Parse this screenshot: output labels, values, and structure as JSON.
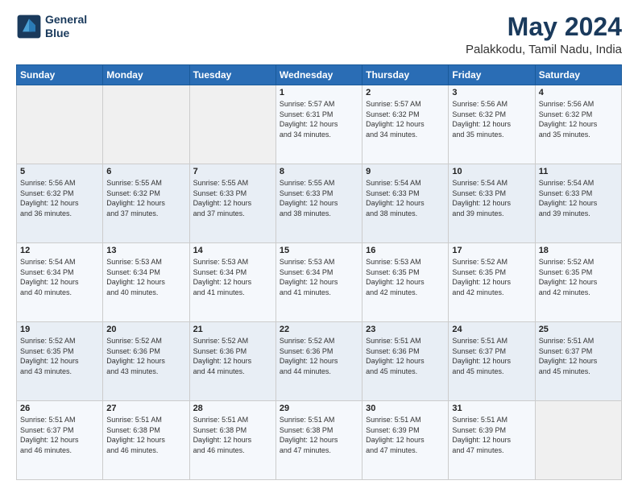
{
  "logo": {
    "line1": "General",
    "line2": "Blue"
  },
  "title": "May 2024",
  "subtitle": "Palakkodu, Tamil Nadu, India",
  "days_of_week": [
    "Sunday",
    "Monday",
    "Tuesday",
    "Wednesday",
    "Thursday",
    "Friday",
    "Saturday"
  ],
  "weeks": [
    [
      {
        "day": "",
        "info": ""
      },
      {
        "day": "",
        "info": ""
      },
      {
        "day": "",
        "info": ""
      },
      {
        "day": "1",
        "info": "Sunrise: 5:57 AM\nSunset: 6:31 PM\nDaylight: 12 hours\nand 34 minutes."
      },
      {
        "day": "2",
        "info": "Sunrise: 5:57 AM\nSunset: 6:32 PM\nDaylight: 12 hours\nand 34 minutes."
      },
      {
        "day": "3",
        "info": "Sunrise: 5:56 AM\nSunset: 6:32 PM\nDaylight: 12 hours\nand 35 minutes."
      },
      {
        "day": "4",
        "info": "Sunrise: 5:56 AM\nSunset: 6:32 PM\nDaylight: 12 hours\nand 35 minutes."
      }
    ],
    [
      {
        "day": "5",
        "info": "Sunrise: 5:56 AM\nSunset: 6:32 PM\nDaylight: 12 hours\nand 36 minutes."
      },
      {
        "day": "6",
        "info": "Sunrise: 5:55 AM\nSunset: 6:32 PM\nDaylight: 12 hours\nand 37 minutes."
      },
      {
        "day": "7",
        "info": "Sunrise: 5:55 AM\nSunset: 6:33 PM\nDaylight: 12 hours\nand 37 minutes."
      },
      {
        "day": "8",
        "info": "Sunrise: 5:55 AM\nSunset: 6:33 PM\nDaylight: 12 hours\nand 38 minutes."
      },
      {
        "day": "9",
        "info": "Sunrise: 5:54 AM\nSunset: 6:33 PM\nDaylight: 12 hours\nand 38 minutes."
      },
      {
        "day": "10",
        "info": "Sunrise: 5:54 AM\nSunset: 6:33 PM\nDaylight: 12 hours\nand 39 minutes."
      },
      {
        "day": "11",
        "info": "Sunrise: 5:54 AM\nSunset: 6:33 PM\nDaylight: 12 hours\nand 39 minutes."
      }
    ],
    [
      {
        "day": "12",
        "info": "Sunrise: 5:54 AM\nSunset: 6:34 PM\nDaylight: 12 hours\nand 40 minutes."
      },
      {
        "day": "13",
        "info": "Sunrise: 5:53 AM\nSunset: 6:34 PM\nDaylight: 12 hours\nand 40 minutes."
      },
      {
        "day": "14",
        "info": "Sunrise: 5:53 AM\nSunset: 6:34 PM\nDaylight: 12 hours\nand 41 minutes."
      },
      {
        "day": "15",
        "info": "Sunrise: 5:53 AM\nSunset: 6:34 PM\nDaylight: 12 hours\nand 41 minutes."
      },
      {
        "day": "16",
        "info": "Sunrise: 5:53 AM\nSunset: 6:35 PM\nDaylight: 12 hours\nand 42 minutes."
      },
      {
        "day": "17",
        "info": "Sunrise: 5:52 AM\nSunset: 6:35 PM\nDaylight: 12 hours\nand 42 minutes."
      },
      {
        "day": "18",
        "info": "Sunrise: 5:52 AM\nSunset: 6:35 PM\nDaylight: 12 hours\nand 42 minutes."
      }
    ],
    [
      {
        "day": "19",
        "info": "Sunrise: 5:52 AM\nSunset: 6:35 PM\nDaylight: 12 hours\nand 43 minutes."
      },
      {
        "day": "20",
        "info": "Sunrise: 5:52 AM\nSunset: 6:36 PM\nDaylight: 12 hours\nand 43 minutes."
      },
      {
        "day": "21",
        "info": "Sunrise: 5:52 AM\nSunset: 6:36 PM\nDaylight: 12 hours\nand 44 minutes."
      },
      {
        "day": "22",
        "info": "Sunrise: 5:52 AM\nSunset: 6:36 PM\nDaylight: 12 hours\nand 44 minutes."
      },
      {
        "day": "23",
        "info": "Sunrise: 5:51 AM\nSunset: 6:36 PM\nDaylight: 12 hours\nand 45 minutes."
      },
      {
        "day": "24",
        "info": "Sunrise: 5:51 AM\nSunset: 6:37 PM\nDaylight: 12 hours\nand 45 minutes."
      },
      {
        "day": "25",
        "info": "Sunrise: 5:51 AM\nSunset: 6:37 PM\nDaylight: 12 hours\nand 45 minutes."
      }
    ],
    [
      {
        "day": "26",
        "info": "Sunrise: 5:51 AM\nSunset: 6:37 PM\nDaylight: 12 hours\nand 46 minutes."
      },
      {
        "day": "27",
        "info": "Sunrise: 5:51 AM\nSunset: 6:38 PM\nDaylight: 12 hours\nand 46 minutes."
      },
      {
        "day": "28",
        "info": "Sunrise: 5:51 AM\nSunset: 6:38 PM\nDaylight: 12 hours\nand 46 minutes."
      },
      {
        "day": "29",
        "info": "Sunrise: 5:51 AM\nSunset: 6:38 PM\nDaylight: 12 hours\nand 47 minutes."
      },
      {
        "day": "30",
        "info": "Sunrise: 5:51 AM\nSunset: 6:39 PM\nDaylight: 12 hours\nand 47 minutes."
      },
      {
        "day": "31",
        "info": "Sunrise: 5:51 AM\nSunset: 6:39 PM\nDaylight: 12 hours\nand 47 minutes."
      },
      {
        "day": "",
        "info": ""
      }
    ]
  ]
}
